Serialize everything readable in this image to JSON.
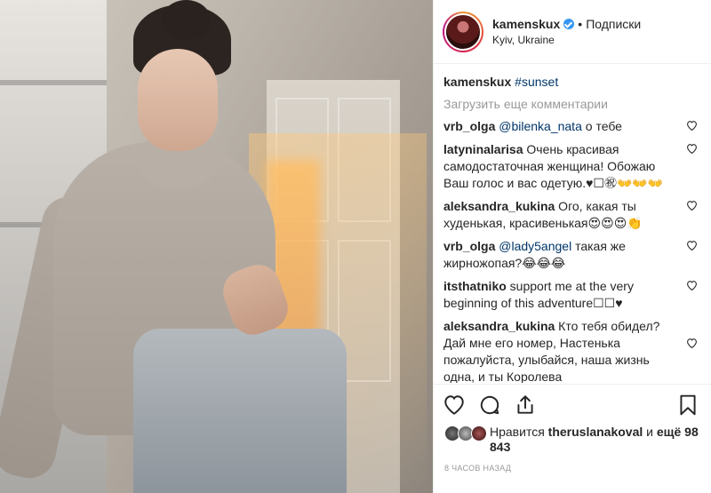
{
  "post": {
    "username": "kamenskux",
    "follow_label": "Подписки",
    "location": "Kyiv, Ukraine",
    "caption_user": "kamenskux",
    "caption_hashtag": "#sunset",
    "load_more_label": "Загрузить еще комментарии",
    "comments": [
      {
        "user": "vrb_olga",
        "mention": "@bilenka_nata",
        "text": " о тебе"
      },
      {
        "user": "latyninalarisa",
        "mention": "",
        "text": " Очень красивая самодостаточная женщина! Обожаю Ваш голос и вас одетую.♥︎☐㊗︎👐👐👐"
      },
      {
        "user": "aleksandra_kukina",
        "mention": "",
        "text": " Ого, какая ты худенькая, красивенькая😍😍😍👏"
      },
      {
        "user": "vrb_olga",
        "mention": "@lady5angel",
        "text": " такая же жирножопая?😂😂😂"
      },
      {
        "user": "itsthatniko",
        "mention": "",
        "text": " support me at the very beginning of this adventure☐☐♥︎"
      },
      {
        "user": "aleksandra_kukina",
        "mention": "",
        "text": " Кто тебя обидел? Дай мне его номер, Настенька пожалуйста, улыбайся, наша жизнь одна, и ты Королева"
      }
    ],
    "likes_prefix": "Нравится ",
    "likes_user": "theruslanakoval",
    "likes_mid": " и ",
    "likes_count": "ещё 98 843",
    "timestamp": "8 ЧАСОВ НАЗАД"
  },
  "icons": {
    "like": "heart-icon",
    "comment": "comment-bubble-icon",
    "share": "share-icon",
    "save": "bookmark-icon"
  },
  "colors": {
    "link": "#003569",
    "verified": "#3897f0",
    "muted": "#999999"
  }
}
